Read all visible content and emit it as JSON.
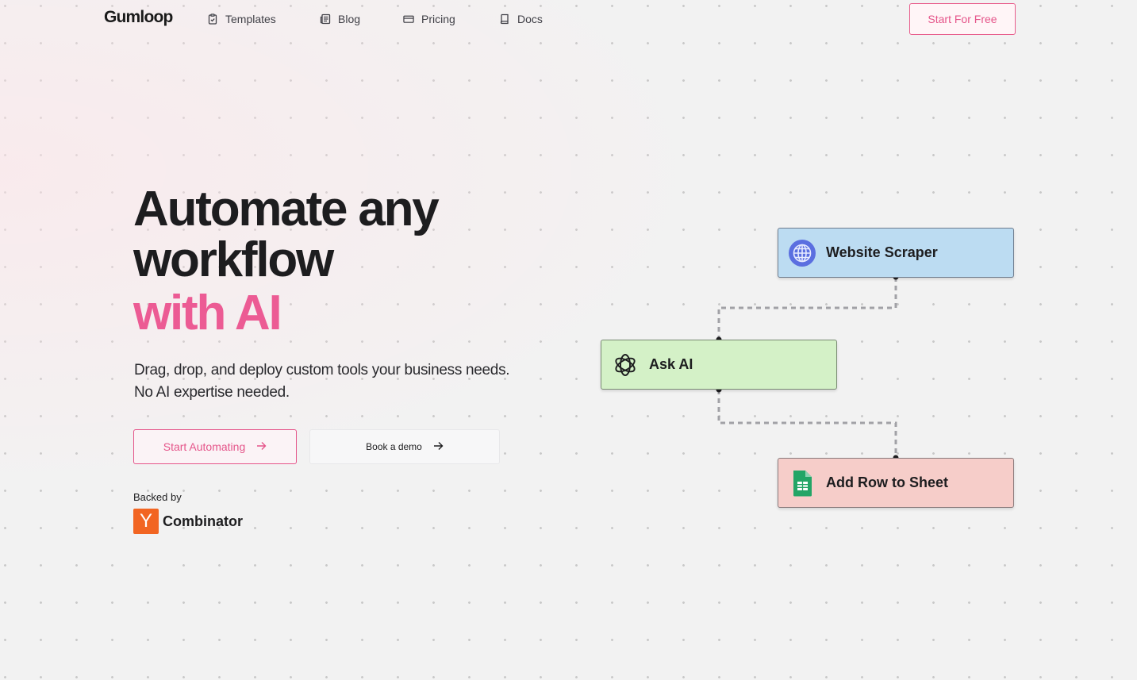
{
  "nav": {
    "logo": "Gumloop",
    "links": [
      {
        "label": "Templates",
        "icon": "clipboard-icon"
      },
      {
        "label": "Blog",
        "icon": "newspaper-icon"
      },
      {
        "label": "Pricing",
        "icon": "credit-card-icon"
      },
      {
        "label": "Docs",
        "icon": "book-icon"
      }
    ],
    "cta": "Start For Free"
  },
  "hero": {
    "headline_line1": "Automate any",
    "headline_line2": "workflow",
    "headline_accent": "with AI",
    "sub_line1": "Drag, drop, and deploy custom tools your business needs.",
    "sub_line2": "No AI expertise needed.",
    "primary_button": "Start Automating",
    "secondary_button": "Book a demo",
    "backed_by": "Backed by",
    "backer_logo_letter": "Y",
    "backer_name": "Combinator"
  },
  "flow": {
    "nodes": [
      {
        "label": "Website Scraper",
        "icon": "globe-icon"
      },
      {
        "label": "Ask AI",
        "icon": "openai-icon"
      },
      {
        "label": "Add Row to Sheet",
        "icon": "google-sheets-icon"
      }
    ]
  },
  "colors": {
    "accent": "#ec5b94",
    "background": "#f2f2f2",
    "scraper_node": "#bcdcf2",
    "ai_node": "#d4f1c7",
    "sheet_node": "#f6cdc9",
    "yc_orange": "#f26522"
  }
}
